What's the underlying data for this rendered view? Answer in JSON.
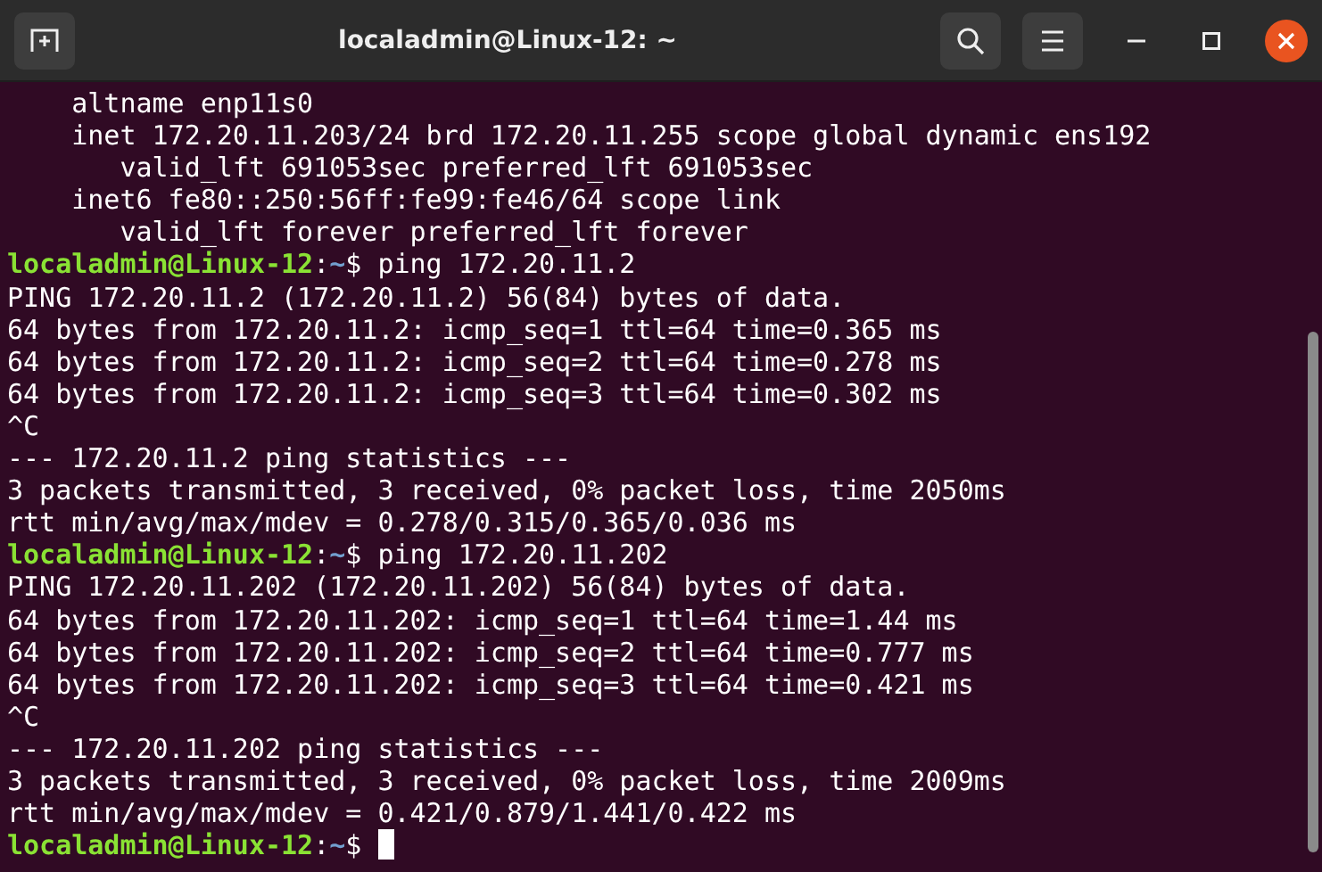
{
  "window": {
    "title": "localadmin@Linux-12: ~"
  },
  "terminal": {
    "lines": [
      {
        "kind": "output",
        "text": "    altname enp11s0"
      },
      {
        "kind": "output",
        "text": "    inet 172.20.11.203/24 brd 172.20.11.255 scope global dynamic ens192"
      },
      {
        "kind": "output",
        "text": "       valid_lft 691053sec preferred_lft 691053sec"
      },
      {
        "kind": "output",
        "text": "    inet6 fe80::250:56ff:fe99:fe46/64 scope link"
      },
      {
        "kind": "output",
        "text": "       valid_lft forever preferred_lft forever"
      },
      {
        "kind": "prompt",
        "user": "localadmin@Linux-12",
        "sep": ":",
        "path": "~",
        "symbol": "$",
        "command": " ping 172.20.11.2",
        "cursor": false
      },
      {
        "kind": "output",
        "text": "PING 172.20.11.2 (172.20.11.2) 56(84) bytes of data."
      },
      {
        "kind": "output",
        "text": "64 bytes from 172.20.11.2: icmp_seq=1 ttl=64 time=0.365 ms"
      },
      {
        "kind": "output",
        "text": "64 bytes from 172.20.11.2: icmp_seq=2 ttl=64 time=0.278 ms"
      },
      {
        "kind": "output",
        "text": "64 bytes from 172.20.11.2: icmp_seq=3 ttl=64 time=0.302 ms"
      },
      {
        "kind": "output",
        "text": "^C"
      },
      {
        "kind": "output",
        "text": "--- 172.20.11.2 ping statistics ---"
      },
      {
        "kind": "output",
        "text": "3 packets transmitted, 3 received, 0% packet loss, time 2050ms"
      },
      {
        "kind": "output",
        "text": "rtt min/avg/max/mdev = 0.278/0.315/0.365/0.036 ms"
      },
      {
        "kind": "prompt",
        "user": "localadmin@Linux-12",
        "sep": ":",
        "path": "~",
        "symbol": "$",
        "command": " ping 172.20.11.202",
        "cursor": false
      },
      {
        "kind": "output",
        "text": "PING 172.20.11.202 (172.20.11.202) 56(84) bytes of data."
      },
      {
        "kind": "output",
        "text": "64 bytes from 172.20.11.202: icmp_seq=1 ttl=64 time=1.44 ms"
      },
      {
        "kind": "output",
        "text": "64 bytes from 172.20.11.202: icmp_seq=2 ttl=64 time=0.777 ms"
      },
      {
        "kind": "output",
        "text": "64 bytes from 172.20.11.202: icmp_seq=3 ttl=64 time=0.421 ms"
      },
      {
        "kind": "output",
        "text": "^C"
      },
      {
        "kind": "output",
        "text": "--- 172.20.11.202 ping statistics ---"
      },
      {
        "kind": "output",
        "text": "3 packets transmitted, 3 received, 0% packet loss, time 2009ms"
      },
      {
        "kind": "output",
        "text": "rtt min/avg/max/mdev = 0.421/0.879/1.441/0.422 ms"
      },
      {
        "kind": "prompt",
        "user": "localadmin@Linux-12",
        "sep": ":",
        "path": "~",
        "symbol": "$",
        "cursor": true
      }
    ]
  }
}
